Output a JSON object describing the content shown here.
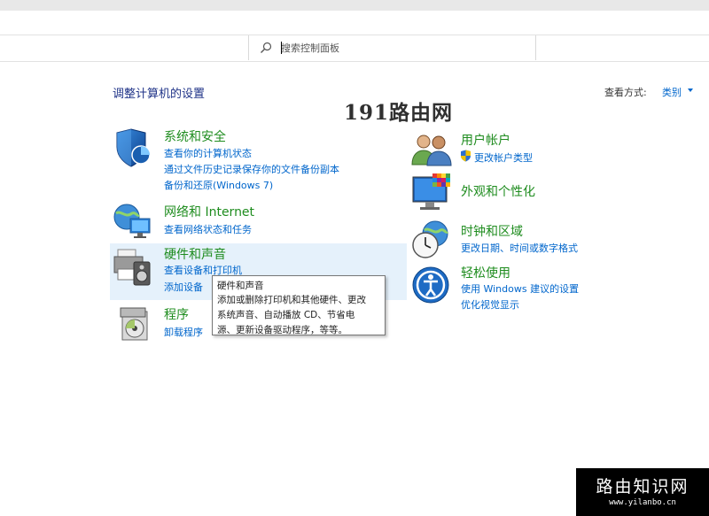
{
  "search": {
    "placeholder": "搜索控制面板"
  },
  "page_title": "调整计算机的设置",
  "view_by": {
    "label": "查看方式:",
    "value": "类别"
  },
  "watermark_top": "191路由网",
  "categories_left": [
    {
      "title": "系统和安全",
      "links": [
        "查看你的计算机状态",
        "通过文件历史记录保存你的文件备份副本",
        "备份和还原(Windows 7)"
      ]
    },
    {
      "title": "网络和 Internet",
      "links": [
        "查看网络状态和任务"
      ]
    },
    {
      "title": "硬件和声音",
      "links": [
        "查看设备和打印机",
        "添加设备"
      ]
    },
    {
      "title": "程序",
      "links": [
        "卸载程序"
      ]
    }
  ],
  "categories_right": [
    {
      "title": "用户帐户",
      "links": [
        "更改帐户类型"
      ]
    },
    {
      "title": "外观和个性化",
      "links": []
    },
    {
      "title": "时钟和区域",
      "links": [
        "更改日期、时间或数字格式"
      ]
    },
    {
      "title": "轻松使用",
      "links": [
        "使用 Windows 建议的设置",
        "优化视觉显示"
      ]
    }
  ],
  "tooltip": {
    "title": "硬件和声音",
    "lines": [
      "添加或删除打印机和其他硬件、更改",
      "系统声音、自动播放 CD、节省电",
      "源、更新设备驱动程序，等等。"
    ]
  },
  "watermark_bottom": {
    "title": "路由知识网",
    "url": "www.yilanbo.cn"
  },
  "colors": {
    "title_green": "#1e8c1e",
    "link_blue": "#0066cc",
    "heading_blue": "#1e3287",
    "hover_bg": "#e5f1fb"
  }
}
